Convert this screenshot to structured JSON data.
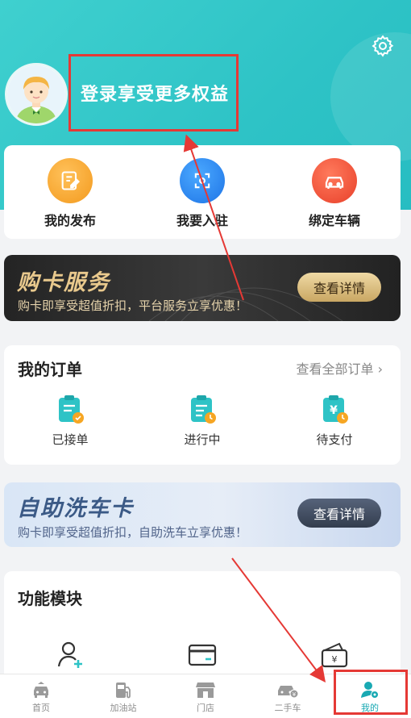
{
  "header": {
    "login_text": "登录享受更多权益"
  },
  "actions": [
    {
      "label": "我的发布",
      "icon": "edit-icon",
      "color": "#f5a623"
    },
    {
      "label": "我要入驻",
      "icon": "enter-icon",
      "color": "#2f8df2"
    },
    {
      "label": "绑定车辆",
      "icon": "car-icon",
      "color": "#f0543c"
    }
  ],
  "buy_card": {
    "title": "购卡服务",
    "subtitle": "购卡即享受超值折扣，平台服务立享优惠！",
    "button": "查看详情"
  },
  "orders": {
    "title": "我的订单",
    "view_all": "查看全部订单 ›",
    "items": [
      {
        "label": "已接单",
        "icon": "order-accepted-icon"
      },
      {
        "label": "进行中",
        "icon": "order-in-progress-icon"
      },
      {
        "label": "待支付",
        "icon": "order-pending-payment-icon"
      }
    ]
  },
  "wash_card": {
    "title": "自助洗车卡",
    "subtitle": "购卡即享受超值折扣，自助洗车立享优惠！",
    "button": "查看详情"
  },
  "modules": {
    "title": "功能模块",
    "icons": [
      "add-user-icon",
      "card-icon",
      "wallet-icon"
    ]
  },
  "tabbar": [
    {
      "label": "首页",
      "icon": "home-car-icon",
      "active": false
    },
    {
      "label": "加油站",
      "icon": "gas-station-icon",
      "active": false
    },
    {
      "label": "门店",
      "icon": "store-icon",
      "active": false
    },
    {
      "label": "二手车",
      "icon": "used-car-icon",
      "active": false
    },
    {
      "label": "我的",
      "icon": "profile-icon",
      "active": true
    }
  ],
  "colors": {
    "brand_teal": "#2ec3c6",
    "active_tab": "#19a9b3",
    "annotation_red": "#e53935"
  }
}
